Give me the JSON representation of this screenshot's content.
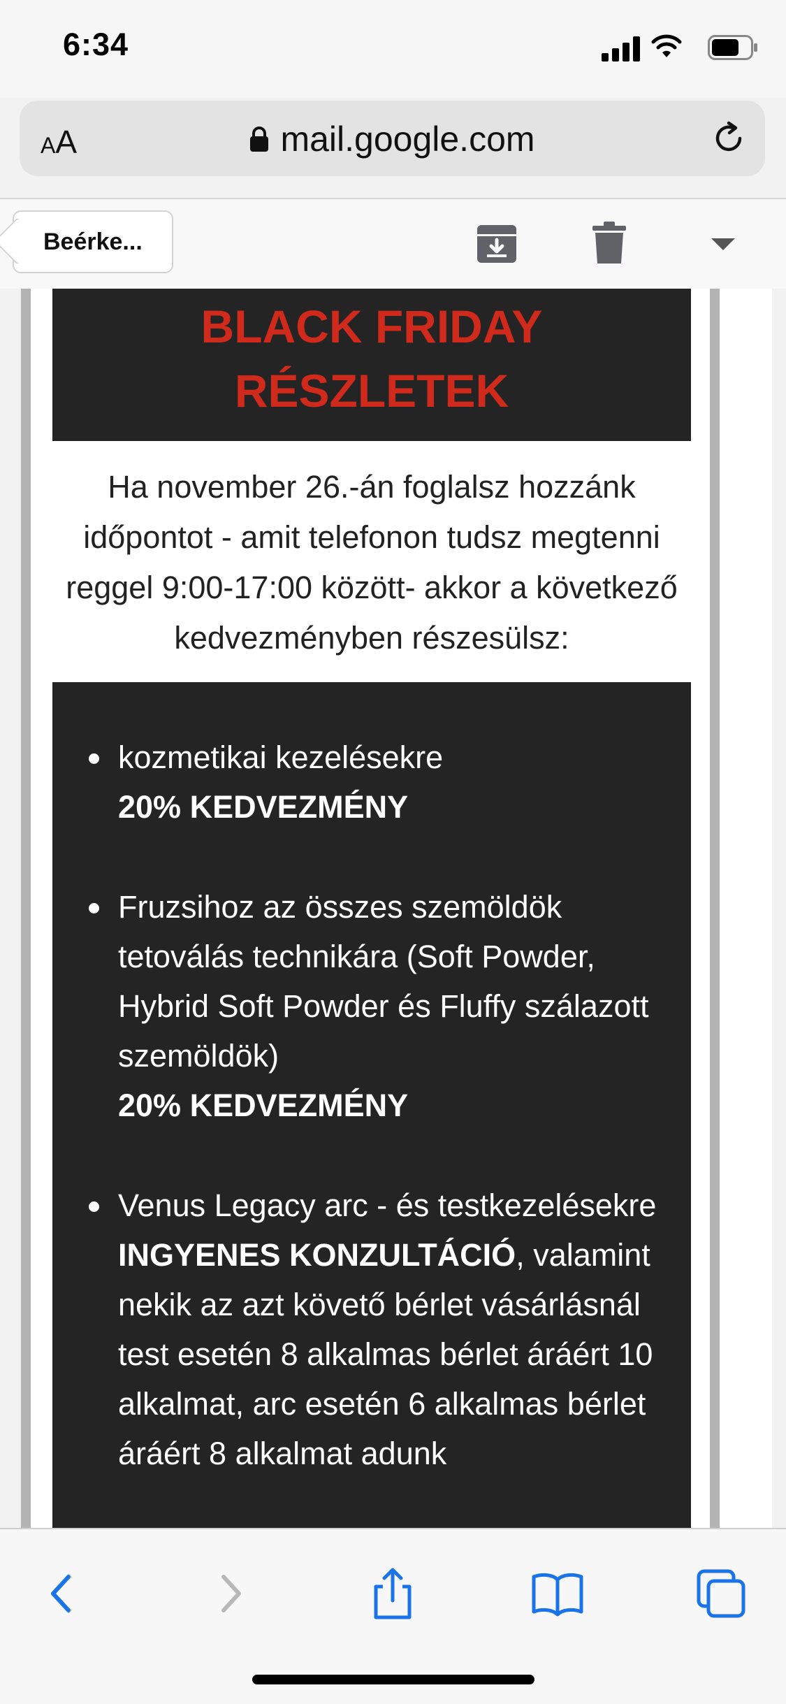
{
  "status_bar": {
    "time": "6:34"
  },
  "browser": {
    "aa_label_small": "A",
    "aa_label_large": "A",
    "url": "mail.google.com"
  },
  "mail_toolbar": {
    "back_label": "Beérke..."
  },
  "email": {
    "title_line1": "BLACK FRIDAY",
    "title_line2": "RÉSZLETEK",
    "intro": "Ha november 26.-án foglalsz hozzánk időpontot - amit telefonon tudsz megtenni reggel 9:00-17:00 között- akkor a következő kedvezményben részesülsz:",
    "offers": [
      {
        "text": "kozmetikai kezelésekre",
        "highlight": "20% KEDVEZMÉNY"
      },
      {
        "text": "Fruzsihoz az összes szemöldök tetoválás technikára (Soft Powder, Hybrid Soft Powder és Fluffy szálazott szemöldök)",
        "highlight": "20% KEDVEZMÉNY"
      },
      {
        "text_before": "Venus Legacy arc - és testkezelésekre",
        "highlight": "INGYENES KONZULTÁCIÓ",
        "text_after": ", valamint nekik az azt követő bérlet vásárlásnál test esetén 8 alkalmas bérlet áráért 10 alkalmat, arc esetén 6 alkalmas bérlet áráért 8 alkalmat adunk"
      }
    ]
  },
  "colors": {
    "title_red": "#cf2a1c",
    "block_dark": "#242424",
    "ios_blue": "#1a73e8"
  },
  "icons": [
    "signal-icon",
    "wifi-icon",
    "battery-icon",
    "lock-icon",
    "reload-icon",
    "archive-icon",
    "trash-icon",
    "caret-down-icon",
    "back-arrow-icon",
    "forward-arrow-icon",
    "share-icon",
    "bookmarks-icon",
    "tabs-icon"
  ]
}
